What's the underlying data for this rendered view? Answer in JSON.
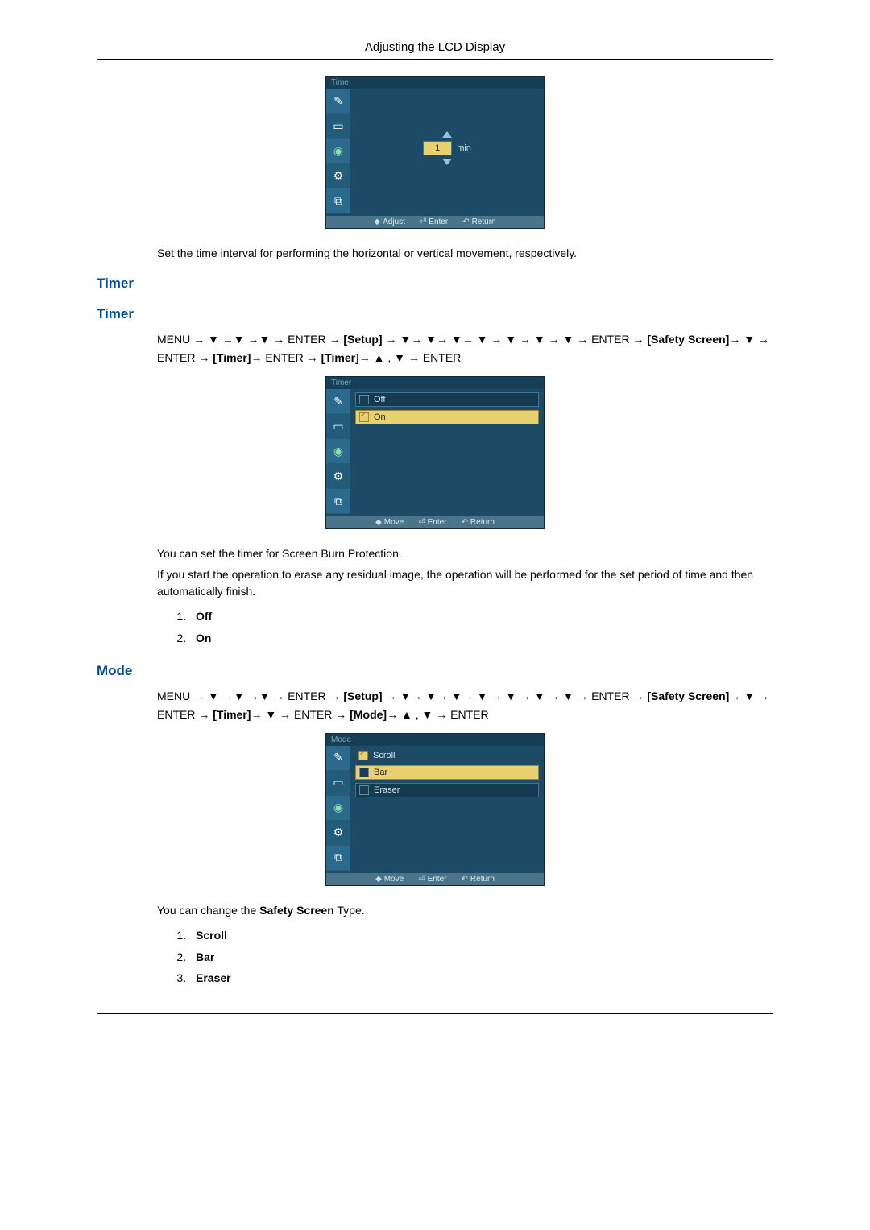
{
  "header": {
    "title": "Adjusting the LCD Display"
  },
  "osd_time": {
    "title": "Time",
    "value": "1",
    "unit": "min",
    "footer": {
      "a": "Adjust",
      "b": "Enter",
      "c": "Return"
    }
  },
  "text_after_time": "Set the time interval for performing the horizontal or vertical movement, respectively.",
  "timer_heading1": "Timer",
  "timer_heading2": "Timer",
  "nav_timer_prefix": "MENU → ▼ →▼ →▼ → ENTER → ",
  "nav_timer_setup": "[Setup]",
  "nav_timer_mid": " → ▼→ ▼→ ▼→ ▼ → ▼ → ▼ → ▼ → ENTER → ",
  "nav_timer_ss": "[Safety Screen]",
  "nav_timer_mid2": "→ ▼ → ENTER → ",
  "nav_timer_t1": "[Timer]",
  "nav_timer_mid3": "→ ENTER → ",
  "nav_timer_t2": "[Timer]",
  "nav_timer_end": "→ ▲ , ▼ → ENTER",
  "osd_timer": {
    "title": "Timer",
    "off": "Off",
    "on": "On",
    "footer": {
      "a": "Move",
      "b": "Enter",
      "c": "Return"
    }
  },
  "timer_desc1": "You can set the timer for Screen Burn Protection.",
  "timer_desc2": "If you start the operation to erase any residual image, the operation will be performed for the set period of time and then automatically finish.",
  "timer_opts": {
    "one": "Off",
    "two": "On"
  },
  "mode_heading": "Mode",
  "nav_mode_prefix": "MENU → ▼ →▼ →▼ → ENTER → ",
  "nav_mode_setup": "[Setup]",
  "nav_mode_mid": " → ▼→ ▼→ ▼→ ▼ → ▼ → ▼ → ▼ → ENTER → ",
  "nav_mode_ss": "[Safety Screen]",
  "nav_mode_mid2": "→ ▼ → ENTER → ",
  "nav_mode_t1": "[Timer]",
  "nav_mode_mid3": "→ ▼ → ENTER → ",
  "nav_mode_m": "[Mode]",
  "nav_mode_end": "→ ▲ , ▼ → ENTER",
  "osd_mode": {
    "title": "Mode",
    "scroll": "Scroll",
    "bar": "Bar",
    "eraser": "Eraser",
    "footer": {
      "a": "Move",
      "b": "Enter",
      "c": "Return"
    }
  },
  "mode_desc_pre": "You can change the ",
  "mode_desc_bold": "Safety Screen",
  "mode_desc_post": " Type.",
  "mode_opts": {
    "one": "Scroll",
    "two": "Bar",
    "three": "Eraser"
  }
}
